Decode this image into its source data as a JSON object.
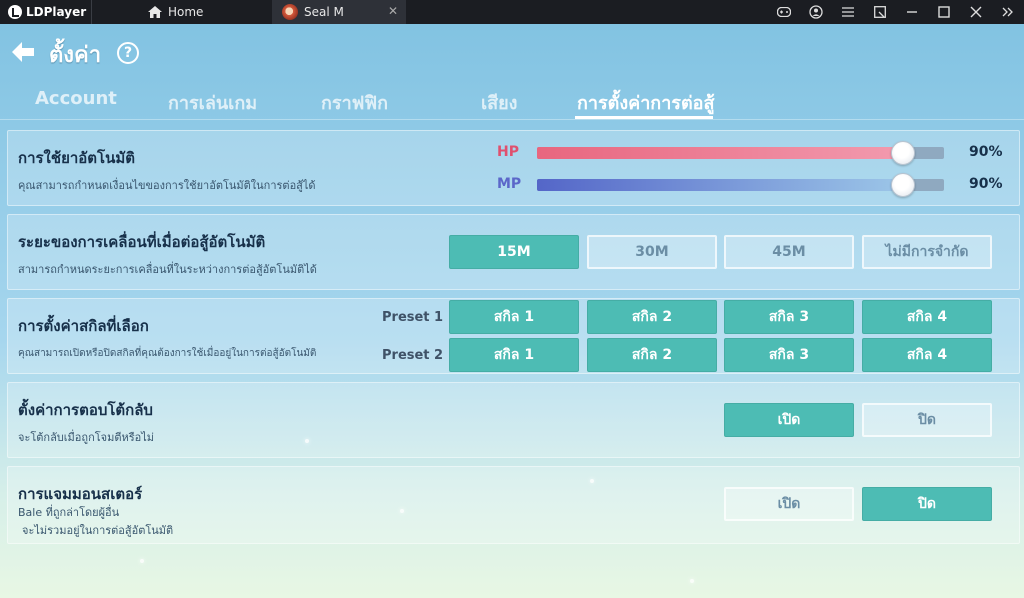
{
  "titlebar": {
    "app_name": "LDPlayer",
    "home_tab": "Home",
    "game_tab": "Seal M",
    "close_glyph": "✕",
    "controls": [
      "gamepad-icon",
      "account-icon",
      "menu-icon",
      "resize-icon",
      "minimize-icon",
      "maximize-icon",
      "close-icon",
      "expand-icon"
    ]
  },
  "header": {
    "title": "ตั้งค่า",
    "help": "?"
  },
  "tabs": [
    {
      "label": "Account"
    },
    {
      "label": "การเล่นเกม"
    },
    {
      "label": "กราฟฟิก"
    },
    {
      "label": "เสียง"
    },
    {
      "label": "การตั้งค่าการต่อสู้",
      "active": true
    }
  ],
  "auto_potion": {
    "title": "การใช้ยาอัตโนมัติ",
    "desc": "คุณสามารถกำหนดเงื่อนไขของการใช้ยาอัตโนมัติในการต่อสู้ได้",
    "hp": {
      "label": "HP",
      "value": "90%",
      "level": 0.9,
      "color": "#e0506e"
    },
    "mp": {
      "label": "MP",
      "value": "90%",
      "level": 0.9,
      "color": "#5b67c9"
    }
  },
  "move_range": {
    "title": "ระยะของการเคลื่อนที่เมื่อต่อสู้อัตโนมัติ",
    "desc": "สามารถกำหนดระยะการเคลื่อนที่ในระหว่างการต่อสู้อัตโนมัติได้",
    "options": [
      "15M",
      "30M",
      "45M",
      "ไม่มีการจำกัด"
    ],
    "selected": "15M"
  },
  "skill_preset": {
    "title": "การตั้งค่าสกิลที่เลือก",
    "desc": "คุณสามารถเปิดหรือปิดสกิลที่คุณต้องการใช้เมื่ออยู่ในการต่อสู้อัตโนมัติ",
    "preset1": {
      "label": "Preset 1",
      "skills": [
        "สกิล 1",
        "สกิล 2",
        "สกิล 3",
        "สกิล 4"
      ]
    },
    "preset2": {
      "label": "Preset 2",
      "skills": [
        "สกิล 1",
        "สกิล 2",
        "สกิล 3",
        "สกิล 4"
      ]
    }
  },
  "counter": {
    "title": "ตั้งค่าการตอบโต้กลับ",
    "desc": "จะโต้กลับเมื่อถูกโจมตีหรือไม่",
    "on_label": "เปิด",
    "off_label": "ปิด",
    "state": "on"
  },
  "monster_jam": {
    "title": "การแจมมอนสเตอร์",
    "desc_line1": "Bale ที่ถูกล่าโดยผู้อื่น",
    "desc_line2": "จะไม่รวมอยู่ในการต่อสู้อัตโนมัติ",
    "on_label": "เปิด",
    "off_label": "ปิด",
    "state": "off"
  },
  "colors": {
    "accent": "#4dbcb4",
    "hp": "#e0506e",
    "mp": "#5b67c9"
  }
}
